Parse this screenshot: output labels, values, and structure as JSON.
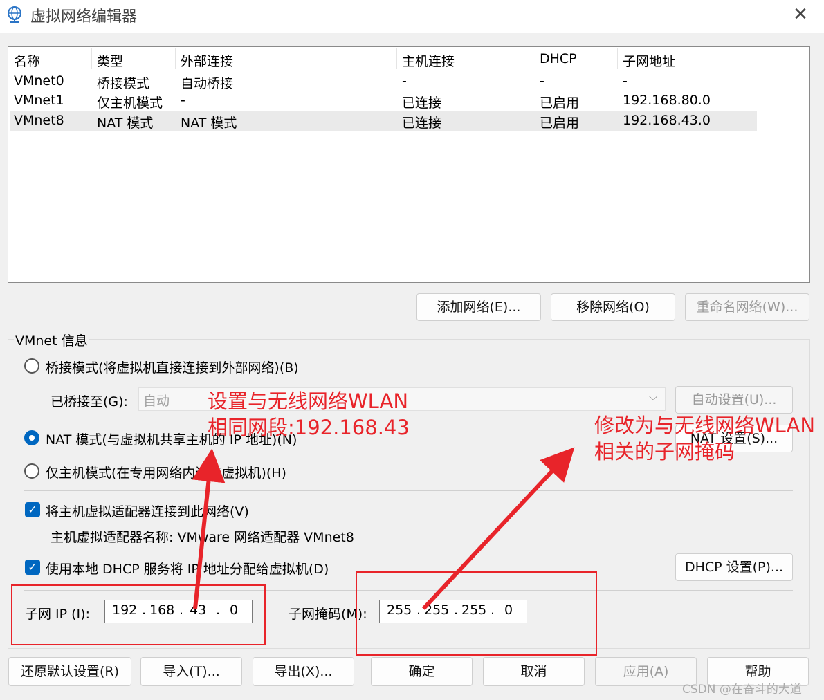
{
  "window": {
    "title": "虚拟网络编辑器",
    "close": "✕"
  },
  "table": {
    "headers": [
      "名称",
      "类型",
      "外部连接",
      "主机连接",
      "DHCP",
      "子网地址"
    ],
    "rows": [
      [
        "VMnet0",
        "桥接模式",
        "自动桥接",
        "-",
        "-",
        "-"
      ],
      [
        "VMnet1",
        "仅主机模式",
        "-",
        "已连接",
        "已启用",
        "192.168.80.0"
      ],
      [
        "VMnet8",
        "NAT 模式",
        "NAT 模式",
        "已连接",
        "已启用",
        "192.168.43.0"
      ]
    ],
    "selected_row": 2
  },
  "net_buttons": {
    "add": "添加网络(E)...",
    "remove": "移除网络(O)",
    "rename": "重命名网络(W)..."
  },
  "info": {
    "group_label": "VMnet 信息",
    "bridge_mode": "桥接模式(将虚拟机直接连接到外部网络)(B)",
    "bridged_to_label": "已桥接至(G):",
    "bridged_to_value": "自动",
    "auto_settings": "自动设置(U)...",
    "nat_mode": "NAT 模式(与虚拟机共享主机的 IP 地址)(N)",
    "nat_settings": "NAT 设置(S)...",
    "host_only_mode": "仅主机模式(在专用网络内连接虚拟机)(H)",
    "connect_adapter": "将主机虚拟适配器连接到此网络(V)",
    "adapter_name": "主机虚拟适配器名称: VMware 网络适配器 VMnet8",
    "use_dhcp": "使用本地 DHCP 服务将 IP 地址分配给虚拟机(D)",
    "dhcp_settings": "DHCP 设置(P)...",
    "subnet_ip_label": "子网 IP (I):",
    "subnet_ip": [
      "192",
      "168",
      "43",
      "0"
    ],
    "subnet_mask_label": "子网掩码(M):",
    "subnet_mask": [
      "255",
      "255",
      "255",
      "0"
    ]
  },
  "bottom_buttons": {
    "restore": "还原默认设置(R)",
    "import": "导入(T)...",
    "export": "导出(X)...",
    "ok": "确定",
    "cancel": "取消",
    "apply": "应用(A)",
    "help": "帮助"
  },
  "annotations": {
    "left_line1": "设置与无线网络WLAN",
    "left_line2": "相同网段:192.168.43",
    "right_line1": "修改为与无线网络WLAN",
    "right_line2": "相关的子网掩码"
  },
  "watermark": "CSDN @在奋斗的大道",
  "colors": {
    "accent": "#0067c0",
    "annotation": "#e8242a"
  },
  "icons": {
    "title": "globe-network-icon"
  }
}
